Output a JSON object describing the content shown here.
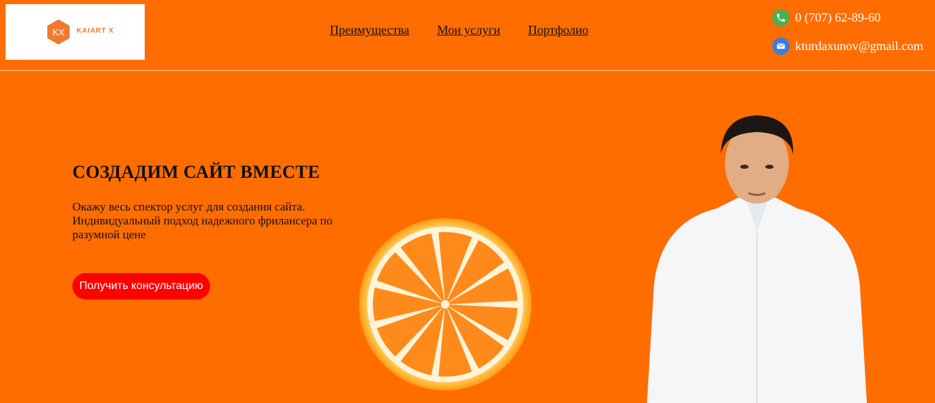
{
  "brand": {
    "logo_text": "KAIART X",
    "logo_mark": "KX",
    "logo_icon": "kx-hexagon-logo-icon"
  },
  "nav": {
    "items": [
      {
        "label": "Преимущества"
      },
      {
        "label": "Мои услуги"
      },
      {
        "label": "Портфолио"
      }
    ]
  },
  "contacts": {
    "phone": {
      "icon": "phone-icon",
      "text": "0 (707) 62-89-60"
    },
    "email": {
      "icon": "mail-icon",
      "text": "kturdaxunov@gmail.com"
    }
  },
  "hero": {
    "title": "СОЗДАДИМ САЙТ ВМЕСТЕ",
    "text": "Окажу весь спектор услуг для создания сайта. Индивидуальный подход надежного фрилансера по разумной цене",
    "cta_label": "Получить консультацию"
  },
  "colors": {
    "background": "#ff6d00",
    "cta": "#ff0000",
    "text_dark": "#111111",
    "contact_text": "#ffffff"
  }
}
